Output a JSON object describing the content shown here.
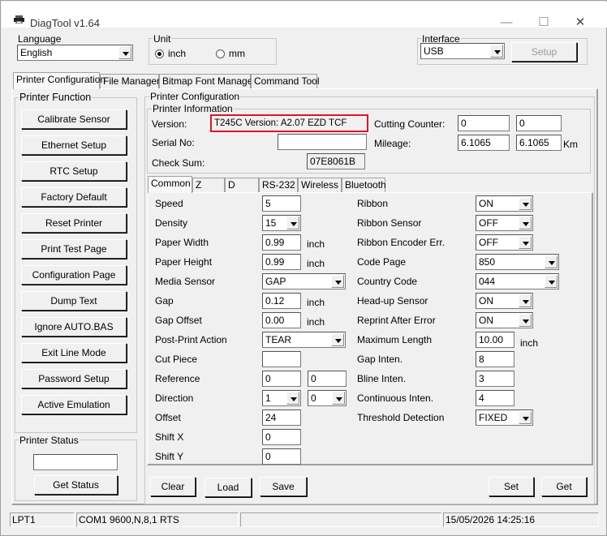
{
  "window": {
    "title": "DiagTool v1.64",
    "minimize": "—",
    "maximize": "☐",
    "close": "✕"
  },
  "language": {
    "label": "Language",
    "value": "English"
  },
  "unit": {
    "label": "Unit",
    "options": [
      "inch",
      "mm"
    ],
    "selected": "inch"
  },
  "interface": {
    "label": "Interface",
    "value": "USB",
    "setup": "Setup"
  },
  "main_tabs": [
    "Printer Configuration",
    "File Manager",
    "Bitmap Font Manager",
    "Command Tool"
  ],
  "printer_function": {
    "label": "Printer Function",
    "buttons": [
      "Calibrate Sensor",
      "Ethernet Setup",
      "RTC Setup",
      "Factory Default",
      "Reset Printer",
      "Print Test Page",
      "Configuration Page",
      "Dump Text",
      "Ignore AUTO.BAS",
      "Exit Line Mode",
      "Password Setup",
      "Active Emulation"
    ]
  },
  "printer_status": {
    "label": "Printer Status",
    "value": "",
    "get_status": "Get Status"
  },
  "printer_config": {
    "label": "Printer Configuration",
    "info_label": "Printer Information",
    "version_label": "Version:",
    "version_value": "T245C Version: A2.07 EZD  TCF",
    "serial_label": "Serial No:",
    "serial_value": "",
    "checksum_label": "Check Sum:",
    "checksum_value": "07E8061B",
    "cutting_label": "Cutting Counter:",
    "cutting_1": "0",
    "cutting_2": "0",
    "mileage_label": "Mileage:",
    "mileage_1": "6.1065",
    "mileage_2": "6.1065",
    "mileage_unit": "Km",
    "highlight_color": "#e0141e"
  },
  "sub_tabs": [
    "Common",
    "Z",
    "D",
    "RS-232",
    "Wireless",
    "Bluetooth"
  ],
  "common": {
    "speed": {
      "label": "Speed",
      "value": "5"
    },
    "density": {
      "label": "Density",
      "value": "15"
    },
    "paper_width": {
      "label": "Paper Width",
      "value": "0.99",
      "unit": "inch"
    },
    "paper_height": {
      "label": "Paper Height",
      "value": "0.99",
      "unit": "inch"
    },
    "media_sensor": {
      "label": "Media Sensor",
      "value": "GAP"
    },
    "gap": {
      "label": "Gap",
      "value": "0.12",
      "unit": "inch"
    },
    "gap_offset": {
      "label": "Gap Offset",
      "value": "0.00",
      "unit": "inch"
    },
    "post_print": {
      "label": "Post-Print Action",
      "value": "TEAR"
    },
    "cut_piece": {
      "label": "Cut Piece",
      "value": ""
    },
    "reference": {
      "label": "Reference",
      "x": "0",
      "y": "0"
    },
    "direction": {
      "label": "Direction",
      "v1": "1",
      "v2": "0"
    },
    "offset": {
      "label": "Offset",
      "value": "24"
    },
    "shift_x": {
      "label": "Shift X",
      "value": "0"
    },
    "shift_y": {
      "label": "Shift Y",
      "value": "0"
    },
    "ribbon": {
      "label": "Ribbon",
      "value": "ON"
    },
    "ribbon_sensor": {
      "label": "Ribbon Sensor",
      "value": "OFF"
    },
    "ribbon_encoder": {
      "label": "Ribbon Encoder Err.",
      "value": "OFF"
    },
    "code_page": {
      "label": "Code Page",
      "value": "850"
    },
    "country_code": {
      "label": "Country Code",
      "value": "044"
    },
    "headup_sensor": {
      "label": "Head-up Sensor",
      "value": "ON"
    },
    "reprint": {
      "label": "Reprint After Error",
      "value": "ON"
    },
    "max_length": {
      "label": "Maximum Length",
      "value": "10.00",
      "unit": "inch"
    },
    "gap_inten": {
      "label": "Gap Inten.",
      "value": "8"
    },
    "bline_inten": {
      "label": "Bline Inten.",
      "value": "3"
    },
    "continuous_inten": {
      "label": "Continuous Inten.",
      "value": "4"
    },
    "threshold": {
      "label": "Threshold Detection",
      "value": "FIXED"
    }
  },
  "bottom_buttons": {
    "clear": "Clear",
    "load": "Load",
    "save": "Save",
    "set": "Set",
    "get": "Get"
  },
  "statusbar": {
    "port": "LPT1",
    "com": "COM1 9600,N,8,1 RTS",
    "empty": "",
    "datetime": "15/05/2026 14:25:16"
  }
}
